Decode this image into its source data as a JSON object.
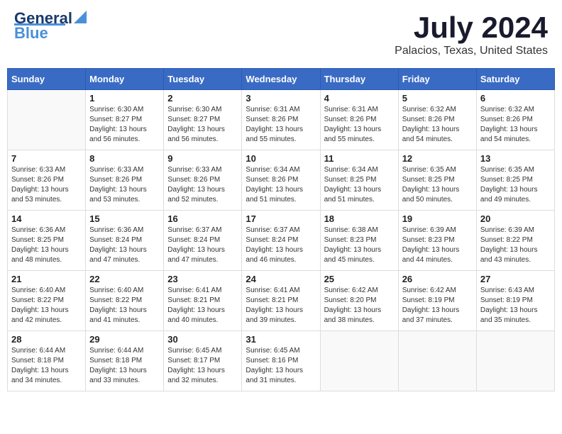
{
  "header": {
    "logo_line1": "General",
    "logo_line2": "Blue",
    "month_year": "July 2024",
    "location": "Palacios, Texas, United States"
  },
  "weekdays": [
    "Sunday",
    "Monday",
    "Tuesday",
    "Wednesday",
    "Thursday",
    "Friday",
    "Saturday"
  ],
  "weeks": [
    [
      {
        "day": "",
        "sunrise": "",
        "sunset": "",
        "daylight": ""
      },
      {
        "day": "1",
        "sunrise": "Sunrise: 6:30 AM",
        "sunset": "Sunset: 8:27 PM",
        "daylight": "Daylight: 13 hours and 56 minutes."
      },
      {
        "day": "2",
        "sunrise": "Sunrise: 6:30 AM",
        "sunset": "Sunset: 8:27 PM",
        "daylight": "Daylight: 13 hours and 56 minutes."
      },
      {
        "day": "3",
        "sunrise": "Sunrise: 6:31 AM",
        "sunset": "Sunset: 8:26 PM",
        "daylight": "Daylight: 13 hours and 55 minutes."
      },
      {
        "day": "4",
        "sunrise": "Sunrise: 6:31 AM",
        "sunset": "Sunset: 8:26 PM",
        "daylight": "Daylight: 13 hours and 55 minutes."
      },
      {
        "day": "5",
        "sunrise": "Sunrise: 6:32 AM",
        "sunset": "Sunset: 8:26 PM",
        "daylight": "Daylight: 13 hours and 54 minutes."
      },
      {
        "day": "6",
        "sunrise": "Sunrise: 6:32 AM",
        "sunset": "Sunset: 8:26 PM",
        "daylight": "Daylight: 13 hours and 54 minutes."
      }
    ],
    [
      {
        "day": "7",
        "sunrise": "Sunrise: 6:33 AM",
        "sunset": "Sunset: 8:26 PM",
        "daylight": "Daylight: 13 hours and 53 minutes."
      },
      {
        "day": "8",
        "sunrise": "Sunrise: 6:33 AM",
        "sunset": "Sunset: 8:26 PM",
        "daylight": "Daylight: 13 hours and 53 minutes."
      },
      {
        "day": "9",
        "sunrise": "Sunrise: 6:33 AM",
        "sunset": "Sunset: 8:26 PM",
        "daylight": "Daylight: 13 hours and 52 minutes."
      },
      {
        "day": "10",
        "sunrise": "Sunrise: 6:34 AM",
        "sunset": "Sunset: 8:26 PM",
        "daylight": "Daylight: 13 hours and 51 minutes."
      },
      {
        "day": "11",
        "sunrise": "Sunrise: 6:34 AM",
        "sunset": "Sunset: 8:25 PM",
        "daylight": "Daylight: 13 hours and 51 minutes."
      },
      {
        "day": "12",
        "sunrise": "Sunrise: 6:35 AM",
        "sunset": "Sunset: 8:25 PM",
        "daylight": "Daylight: 13 hours and 50 minutes."
      },
      {
        "day": "13",
        "sunrise": "Sunrise: 6:35 AM",
        "sunset": "Sunset: 8:25 PM",
        "daylight": "Daylight: 13 hours and 49 minutes."
      }
    ],
    [
      {
        "day": "14",
        "sunrise": "Sunrise: 6:36 AM",
        "sunset": "Sunset: 8:25 PM",
        "daylight": "Daylight: 13 hours and 48 minutes."
      },
      {
        "day": "15",
        "sunrise": "Sunrise: 6:36 AM",
        "sunset": "Sunset: 8:24 PM",
        "daylight": "Daylight: 13 hours and 47 minutes."
      },
      {
        "day": "16",
        "sunrise": "Sunrise: 6:37 AM",
        "sunset": "Sunset: 8:24 PM",
        "daylight": "Daylight: 13 hours and 47 minutes."
      },
      {
        "day": "17",
        "sunrise": "Sunrise: 6:37 AM",
        "sunset": "Sunset: 8:24 PM",
        "daylight": "Daylight: 13 hours and 46 minutes."
      },
      {
        "day": "18",
        "sunrise": "Sunrise: 6:38 AM",
        "sunset": "Sunset: 8:23 PM",
        "daylight": "Daylight: 13 hours and 45 minutes."
      },
      {
        "day": "19",
        "sunrise": "Sunrise: 6:39 AM",
        "sunset": "Sunset: 8:23 PM",
        "daylight": "Daylight: 13 hours and 44 minutes."
      },
      {
        "day": "20",
        "sunrise": "Sunrise: 6:39 AM",
        "sunset": "Sunset: 8:22 PM",
        "daylight": "Daylight: 13 hours and 43 minutes."
      }
    ],
    [
      {
        "day": "21",
        "sunrise": "Sunrise: 6:40 AM",
        "sunset": "Sunset: 8:22 PM",
        "daylight": "Daylight: 13 hours and 42 minutes."
      },
      {
        "day": "22",
        "sunrise": "Sunrise: 6:40 AM",
        "sunset": "Sunset: 8:22 PM",
        "daylight": "Daylight: 13 hours and 41 minutes."
      },
      {
        "day": "23",
        "sunrise": "Sunrise: 6:41 AM",
        "sunset": "Sunset: 8:21 PM",
        "daylight": "Daylight: 13 hours and 40 minutes."
      },
      {
        "day": "24",
        "sunrise": "Sunrise: 6:41 AM",
        "sunset": "Sunset: 8:21 PM",
        "daylight": "Daylight: 13 hours and 39 minutes."
      },
      {
        "day": "25",
        "sunrise": "Sunrise: 6:42 AM",
        "sunset": "Sunset: 8:20 PM",
        "daylight": "Daylight: 13 hours and 38 minutes."
      },
      {
        "day": "26",
        "sunrise": "Sunrise: 6:42 AM",
        "sunset": "Sunset: 8:19 PM",
        "daylight": "Daylight: 13 hours and 37 minutes."
      },
      {
        "day": "27",
        "sunrise": "Sunrise: 6:43 AM",
        "sunset": "Sunset: 8:19 PM",
        "daylight": "Daylight: 13 hours and 35 minutes."
      }
    ],
    [
      {
        "day": "28",
        "sunrise": "Sunrise: 6:44 AM",
        "sunset": "Sunset: 8:18 PM",
        "daylight": "Daylight: 13 hours and 34 minutes."
      },
      {
        "day": "29",
        "sunrise": "Sunrise: 6:44 AM",
        "sunset": "Sunset: 8:18 PM",
        "daylight": "Daylight: 13 hours and 33 minutes."
      },
      {
        "day": "30",
        "sunrise": "Sunrise: 6:45 AM",
        "sunset": "Sunset: 8:17 PM",
        "daylight": "Daylight: 13 hours and 32 minutes."
      },
      {
        "day": "31",
        "sunrise": "Sunrise: 6:45 AM",
        "sunset": "Sunset: 8:16 PM",
        "daylight": "Daylight: 13 hours and 31 minutes."
      },
      {
        "day": "",
        "sunrise": "",
        "sunset": "",
        "daylight": ""
      },
      {
        "day": "",
        "sunrise": "",
        "sunset": "",
        "daylight": ""
      },
      {
        "day": "",
        "sunrise": "",
        "sunset": "",
        "daylight": ""
      }
    ]
  ]
}
